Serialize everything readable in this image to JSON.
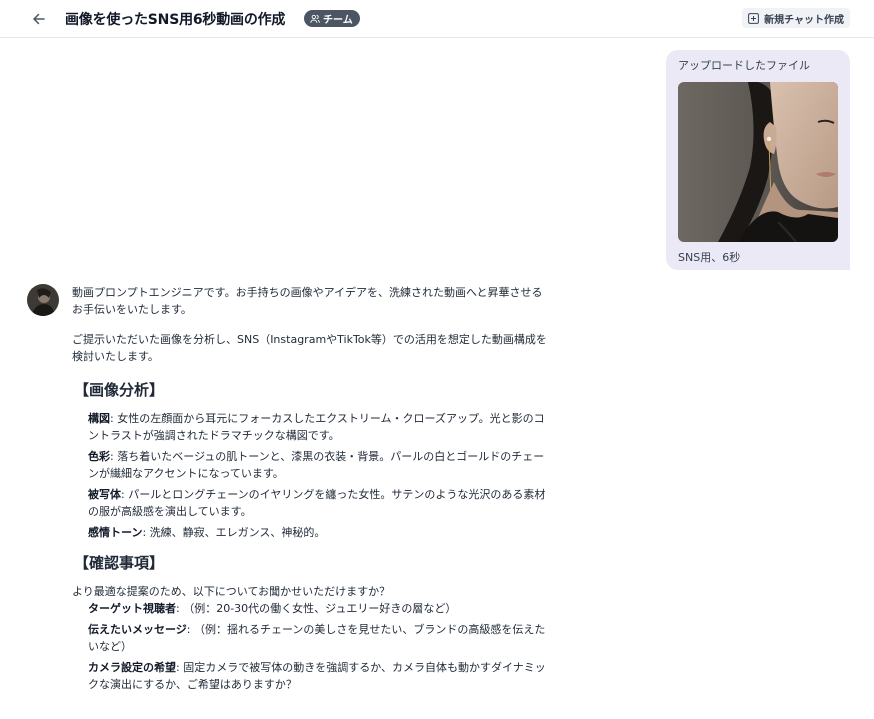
{
  "header": {
    "title": "画像を使ったSNS用6秒動画の作成",
    "team_badge": "チーム",
    "new_chat_label": "新規チャット作成"
  },
  "user_message": {
    "uploaded_label": "アップロードしたファイル",
    "text": "SNS用、6秒"
  },
  "assistant_message": {
    "paragraph1": "動画プロンプトエンジニアです。お手持ちの画像やアイデアを、洗練された動画へと昇華させるお手伝いをいたします。",
    "paragraph2": "ご提示いただいた画像を分析し、SNS（InstagramやTikTok等）での活用を想定した動画構成を検討いたします。",
    "section1": {
      "heading": "【画像分析】",
      "items": [
        {
          "label": "構図",
          "text": ": 女性の左顔面から耳元にフォーカスしたエクストリーム・クローズアップ。光と影のコントラストが強調されたドラマチックな構図です。"
        },
        {
          "label": "色彩",
          "text": ": 落ち着いたベージュの肌トーンと、漆黒の衣装・背景。パールの白とゴールドのチェーンが繊細なアクセントになっています。"
        },
        {
          "label": "被写体",
          "text": ": パールとロングチェーンのイヤリングを纏った女性。サテンのような光沢のある素材の服が高級感を演出しています。"
        },
        {
          "label": "感情トーン",
          "text": ": 洗練、静寂、エレガンス、神秘的。"
        }
      ]
    },
    "section2": {
      "heading": "【確認事項】",
      "intro": "より最適な提案のため、以下についてお聞かせいただけますか？",
      "items": [
        {
          "label": "ターゲット視聴者",
          "text": ": （例：20-30代の働く女性、ジュエリー好きの層など）"
        },
        {
          "label": "伝えたいメッセージ",
          "text": ": （例：揺れるチェーンの美しさを見せたい、ブランドの高級感を伝えたいなど）"
        },
        {
          "label": "カメラ設定の希望",
          "text": ": 固定カメラで被写体の動きを強調するか、カメラ自体も動かすダイナミックな演出にするか、ご希望はありますか？"
        }
      ]
    }
  },
  "icons": {
    "back": "arrow-left-icon",
    "team": "users-icon",
    "new_chat": "plus-square-icon"
  }
}
